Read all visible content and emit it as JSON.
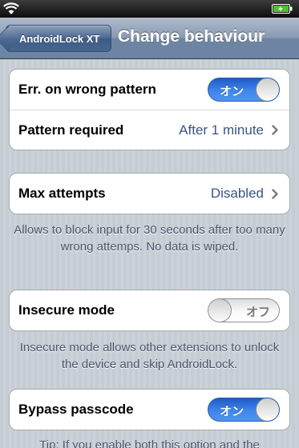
{
  "statusbar": {
    "wifi_icon": "wifi-icon",
    "battery_icon": "battery-charging-icon"
  },
  "navbar": {
    "back_label": "AndroidLock XT",
    "title": "Change behaviour"
  },
  "group1": {
    "err_label": "Err. on wrong pattern",
    "err_switch": {
      "state": "on",
      "text": "オン"
    },
    "pattern_label": "Pattern required",
    "pattern_value": "After 1 minute"
  },
  "group2": {
    "max_label": "Max attempts",
    "max_value": "Disabled",
    "footer": "Allows to block input for 30 seconds after too many wrong attemps. No data is wiped."
  },
  "group3": {
    "insecure_label": "Insecure mode",
    "insecure_switch": {
      "state": "off",
      "text": "オフ"
    },
    "footer": "Insecure mode allows other extensions to unlock the device and skip AndroidLock."
  },
  "group4": {
    "bypass_label": "Bypass passcode",
    "bypass_switch": {
      "state": "on",
      "text": "オン"
    },
    "footer": "Tip: If you enable both this option and the"
  },
  "colors": {
    "accent": "#3f86ec",
    "value_text": "#385487",
    "footer_text": "#4c566c"
  }
}
